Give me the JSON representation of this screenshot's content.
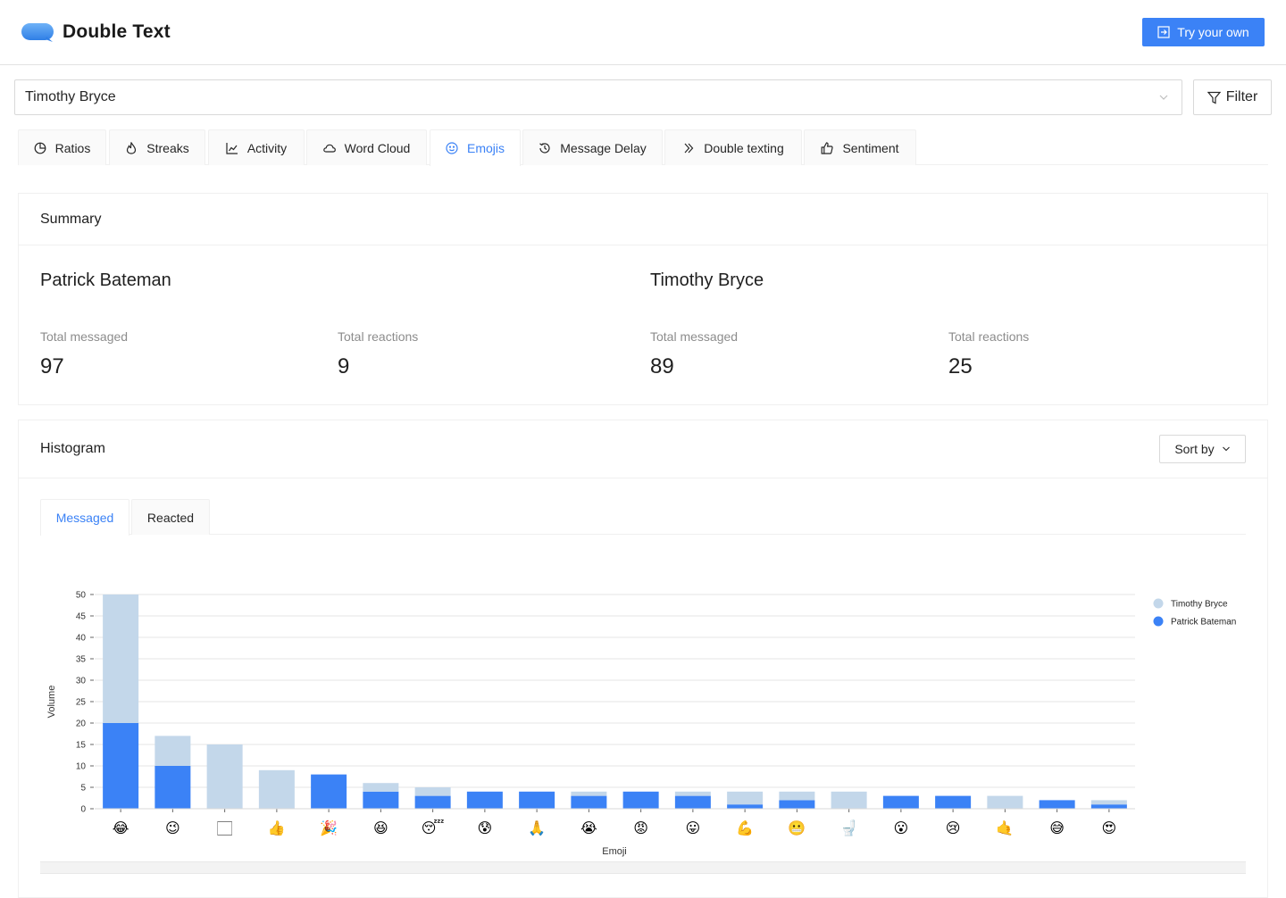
{
  "app": {
    "title": "Double Text",
    "try_label": "Try your own"
  },
  "selector": {
    "value": "Timothy Bryce",
    "filter_label": "Filter"
  },
  "tabs": [
    {
      "label": "Ratios",
      "icon": "pie-chart-icon"
    },
    {
      "label": "Streaks",
      "icon": "fire-icon"
    },
    {
      "label": "Activity",
      "icon": "line-chart-icon"
    },
    {
      "label": "Word Cloud",
      "icon": "cloud-icon"
    },
    {
      "label": "Emojis",
      "icon": "smile-icon",
      "active": true
    },
    {
      "label": "Message Delay",
      "icon": "history-icon"
    },
    {
      "label": "Double texting",
      "icon": "double-right-icon"
    },
    {
      "label": "Sentiment",
      "icon": "like-icon"
    }
  ],
  "summary": {
    "title": "Summary",
    "people": [
      {
        "name": "Patrick Bateman",
        "total_messaged_label": "Total messaged",
        "total_messaged": "97",
        "total_reactions_label": "Total reactions",
        "total_reactions": "9"
      },
      {
        "name": "Timothy Bryce",
        "total_messaged_label": "Total messaged",
        "total_messaged": "89",
        "total_reactions_label": "Total reactions",
        "total_reactions": "25"
      }
    ]
  },
  "histogram": {
    "title": "Histogram",
    "sort_label": "Sort by",
    "subtabs": [
      {
        "label": "Messaged",
        "active": true
      },
      {
        "label": "Reacted"
      }
    ]
  },
  "colors": {
    "accent": "#3b82f6",
    "light_series": "#c3d7ea",
    "dark_series": "#3b82f6"
  },
  "chart_data": {
    "type": "bar",
    "stacked": true,
    "xlabel": "Emoji",
    "ylabel": "Volume",
    "ylim": [
      0,
      50
    ],
    "yticks": [
      0,
      5,
      10,
      15,
      20,
      25,
      30,
      35,
      40,
      45,
      50
    ],
    "grid": true,
    "legend_position": "top-right",
    "categories": [
      "😂",
      "😉",
      "🏻",
      "👍",
      "🎉",
      "😆",
      "😴",
      "😰",
      "🙏",
      "😭",
      "😡",
      "😛",
      "💪",
      "😬",
      "🚽",
      "😮",
      "😢",
      "🤙",
      "😅",
      "😍"
    ],
    "series": [
      {
        "name": "Patrick Bateman",
        "color": "#3b82f6",
        "values": [
          20,
          10,
          0,
          0,
          8,
          4,
          3,
          4,
          4,
          3,
          4,
          3,
          1,
          2,
          0,
          3,
          3,
          0,
          2,
          1
        ]
      },
      {
        "name": "Timothy Bryce",
        "color": "#c3d7ea",
        "values": [
          30,
          7,
          15,
          9,
          0,
          2,
          2,
          0,
          0,
          1,
          0,
          1,
          3,
          2,
          4,
          0,
          0,
          3,
          0,
          1
        ]
      }
    ],
    "legend_order": [
      "Timothy Bryce",
      "Patrick Bateman"
    ]
  }
}
